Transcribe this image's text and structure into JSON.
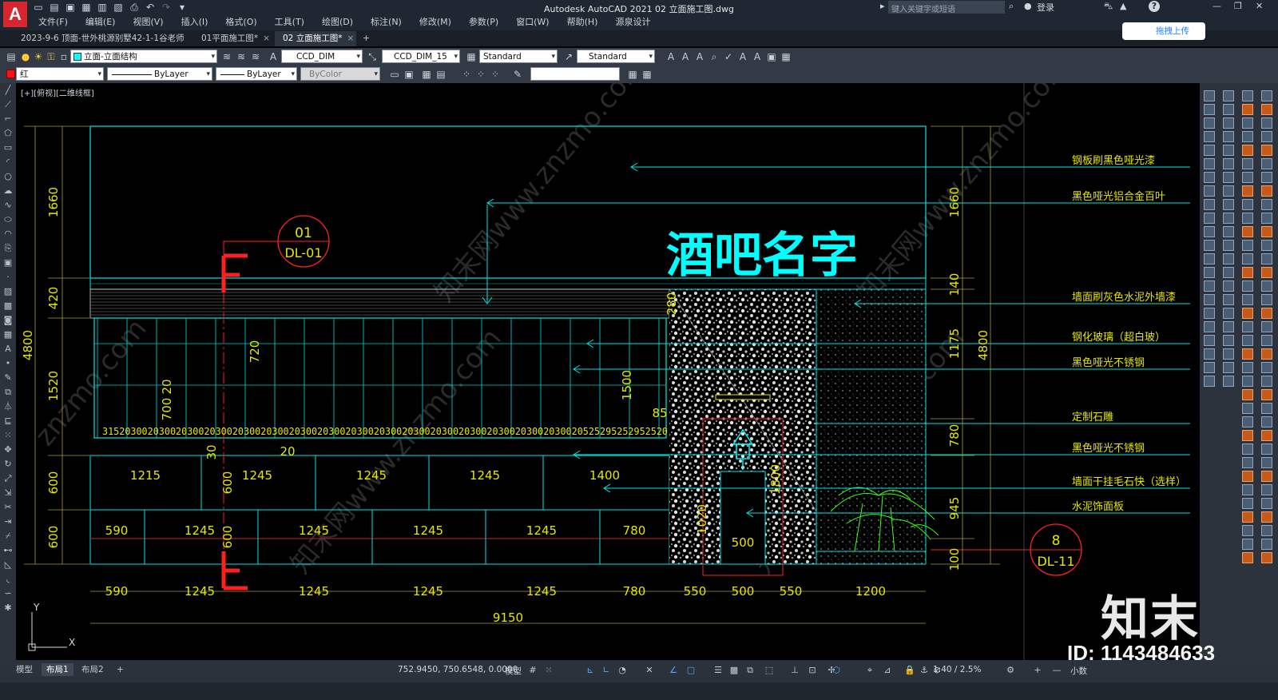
{
  "app": {
    "title": "Autodesk AutoCAD 2021    02 立面施工图.dwg",
    "logo": "A",
    "search_placeholder": "键入关键字或短语",
    "login": "登录",
    "help": "?"
  },
  "menu": [
    "文件(F)",
    "编辑(E)",
    "视图(V)",
    "插入(I)",
    "格式(O)",
    "工具(T)",
    "绘图(D)",
    "标注(N)",
    "修改(M)",
    "参数(P)",
    "窗口(W)",
    "帮助(H)",
    "源泉设计"
  ],
  "tabs": [
    {
      "label": "2023-9-6 顶面-世外桃源别墅42-1-1谷老师*",
      "active": false
    },
    {
      "label": "01平面施工图*",
      "active": false
    },
    {
      "label": "02 立面施工图*",
      "active": true
    }
  ],
  "cloud_button": "拖拽上传",
  "toolbar": {
    "layer": "立面-立面结构",
    "dimstyle1": "CCD_DIM",
    "dimstyle2": "CCD_DIM_15",
    "textstyle": "Standard",
    "mleaderstyle": "Standard",
    "color": "红",
    "linetype": "ByLayer",
    "lineweight": "ByLayer",
    "plotstyle": "ByColor"
  },
  "colors": {
    "accent": "#1d7bff",
    "cyan": "#00ffff",
    "yellow": "#e6e600",
    "red": "#ff2020",
    "green": "#39ff14"
  },
  "view_label": "[+][俯视][二维线框]",
  "drawing": {
    "sign_text": "酒吧名字",
    "callout1": {
      "num": "01",
      "ref": "DL-01"
    },
    "callout2": {
      "num": "8",
      "ref": "DL-11"
    },
    "labels": [
      "钢板刷黑色哑光漆",
      "黑色哑光铝合金百叶",
      "墙面刷灰色水泥外墙漆",
      "钢化玻璃（超白玻）",
      "黑色哑光不锈钢",
      "定制石雕",
      "黑色哑光不锈钢",
      "墙面干挂毛石快（选样）",
      "水泥饰面板"
    ],
    "left_dims": [
      "1660",
      "420",
      "4800",
      "1520",
      "600",
      "600"
    ],
    "right_dims": [
      "1660",
      "140",
      "1175",
      "4800",
      "780",
      "945",
      "100"
    ],
    "glass_dims": [
      "720",
      "700",
      "20",
      "1500",
      "85",
      "30",
      "20",
      "280",
      "1800",
      "1020",
      "500"
    ],
    "glass_bottom": "3152030020300203002030020300203002030020300203002030020300203002030020300203002030020525295252952520",
    "row1": [
      "1215",
      "600",
      "1245",
      "1245",
      "1245",
      "1400"
    ],
    "row2": [
      "590",
      "1245",
      "600",
      "1245",
      "1245",
      "1245",
      "780"
    ],
    "bottom_dims": [
      "590",
      "1245",
      "1245",
      "1245",
      "1245",
      "780",
      "550",
      "500",
      "550",
      "1200"
    ],
    "total": "9150",
    "ucs_y": "Y",
    "ucs_x": "X"
  },
  "status": {
    "tabs": [
      "模型",
      "布局1",
      "布局2",
      "+"
    ],
    "coords": "752.9450, 750.6548, 0.0000",
    "model": "模型",
    "scale": "1:40 / 2.5%",
    "units": "小数"
  },
  "watermark": {
    "brand": "知末",
    "id": "ID: 1143484633"
  }
}
